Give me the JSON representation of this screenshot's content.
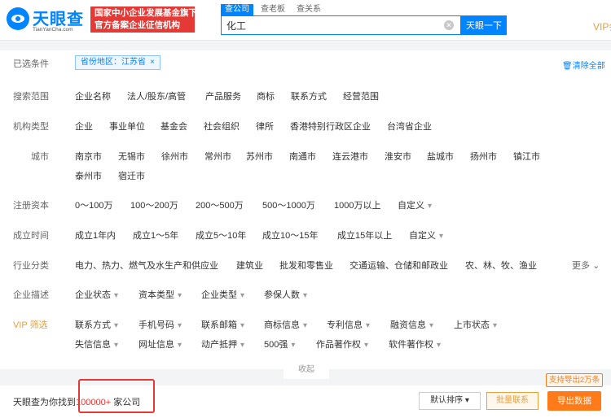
{
  "header": {
    "logo_cn": "天眼查",
    "logo_en": "TianYanCha.com",
    "slogan_line1": "国家中小企业发展基金旗下",
    "slogan_line2": "官方备案企业征信机构",
    "search_tabs": [
      "查公司",
      "查老板",
      "查关系"
    ],
    "search_value": "化工",
    "search_button": "天眼一下",
    "vip_link": "VIP会员"
  },
  "selected": {
    "label": "已选条件",
    "chip": "省份地区：江苏省",
    "chip_close": "×",
    "clear_all": "清除全部"
  },
  "scope": {
    "label": "搜索范围",
    "options": [
      "企业名称",
      "法人/股东/高管",
      "产品服务",
      "商标",
      "联系方式",
      "经营范围"
    ]
  },
  "org_type": {
    "label": "机构类型",
    "options": [
      "企业",
      "事业单位",
      "基金会",
      "社会组织",
      "律所",
      "香港特别行政区企业",
      "台湾省企业"
    ]
  },
  "city": {
    "label": "城市",
    "options": [
      "南京市",
      "无锡市",
      "徐州市",
      "常州市",
      "苏州市",
      "南通市",
      "连云港市",
      "淮安市",
      "盐城市",
      "扬州市",
      "镇江市",
      "泰州市",
      "宿迁市"
    ]
  },
  "capital": {
    "label": "注册资本",
    "options": [
      "0～100万",
      "100～200万",
      "200～500万",
      "500～1000万",
      "1000万以上",
      "自定义"
    ]
  },
  "established": {
    "label": "成立时间",
    "options": [
      "成立1年内",
      "成立1～5年",
      "成立5～10年",
      "成立10～15年",
      "成立15年以上",
      "自定义"
    ]
  },
  "industry": {
    "label": "行业分类",
    "options": [
      "电力、热力、燃气及水生产和供应业",
      "建筑业",
      "批发和零售业",
      "交通运输、仓储和邮政业",
      "农、林、牧、渔业"
    ],
    "more": "更多"
  },
  "description": {
    "label": "企业描述",
    "options": [
      "企业状态",
      "资本类型",
      "企业类型",
      "参保人数"
    ]
  },
  "vip_filter": {
    "label": "VIP 筛选",
    "row1": [
      "联系方式",
      "手机号码",
      "联系邮箱",
      "商标信息",
      "专利信息",
      "融资信息",
      "上市状态"
    ],
    "row2": [
      "失信信息",
      "网址信息",
      "动产抵押",
      "500强",
      "作品著作权",
      "软件著作权"
    ]
  },
  "collapse": "收起",
  "results": {
    "prefix": "天眼查为你找到",
    "count": "100000+",
    "suffix": "家公司",
    "sort": "默认排序",
    "contact": "批量联系",
    "export": "导出数据",
    "export_tip": "支持导出2万条"
  }
}
